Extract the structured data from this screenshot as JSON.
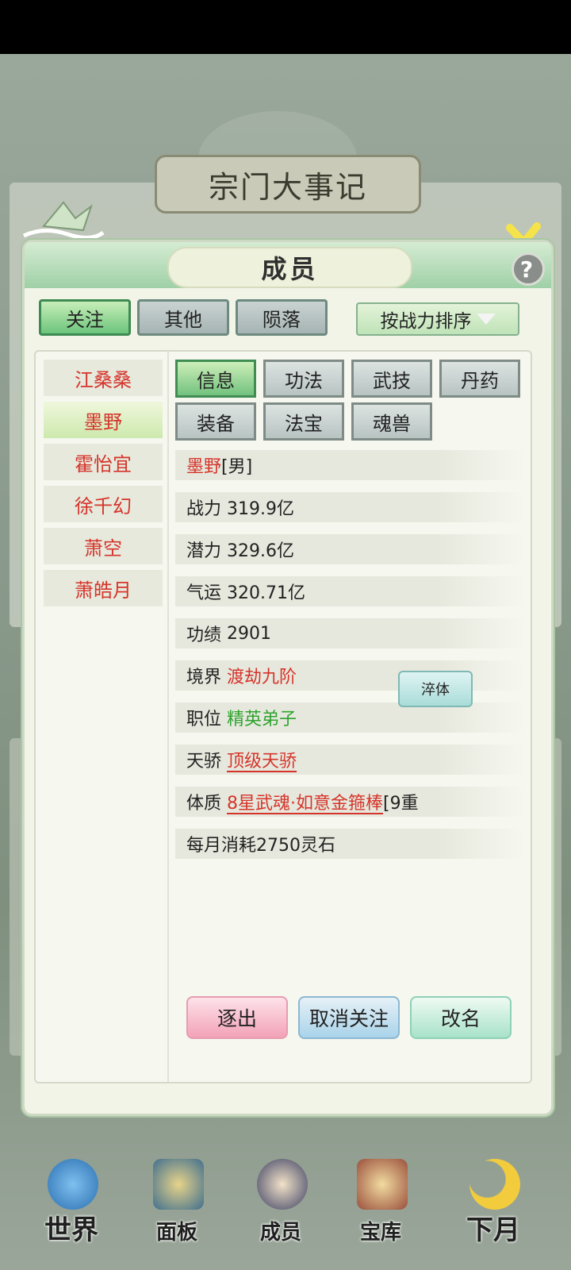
{
  "background": {
    "title": "宗门大事记"
  },
  "dialog": {
    "title": "成员",
    "help_glyph": "?",
    "filter_tabs": [
      "关注",
      "其他",
      "陨落"
    ],
    "sort_label": "按战力排序"
  },
  "members": [
    "江桑桑",
    "墨野",
    "霍怡宜",
    "徐千幻",
    "萧空",
    "萧皓月"
  ],
  "sub_tabs": [
    "信息",
    "功法",
    "武技",
    "丹药",
    "装备",
    "法宝",
    "魂兽"
  ],
  "info": {
    "name": "墨野",
    "gender": "[男]",
    "power_label": "战力",
    "power_value": "319.9亿",
    "potential_label": "潜力",
    "potential_value": "329.6亿",
    "luck_label": "气运",
    "luck_value": "320.71亿",
    "merit_label": "功绩",
    "merit_value": "2901",
    "realm_label": "境界",
    "realm_value": "渡劫九阶",
    "position_label": "职位",
    "position_value": "精英弟子",
    "talent_label": "天骄",
    "talent_value": "顶级天骄",
    "physique_label": "体质",
    "physique_value": "8星武魂·如意金箍棒",
    "physique_suffix": "[9重",
    "temper_button": "淬体",
    "monthly_cost": "每月消耗2750灵石"
  },
  "actions": [
    "逐出",
    "取消关注",
    "改名"
  ],
  "nav": [
    "世界",
    "面板",
    "成员",
    "宝库",
    "下月"
  ],
  "colors": {
    "accent_green": "#6cc47c",
    "name_red": "#d6342b",
    "position_green": "#2ea32e"
  }
}
